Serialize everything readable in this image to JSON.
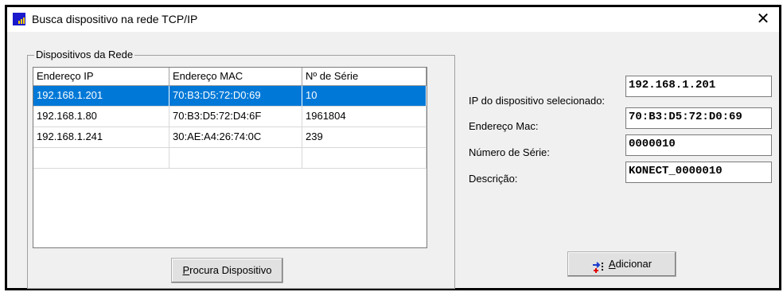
{
  "window": {
    "title": "Busca dispositivo na rede TCP/IP",
    "close_glyph": "✕"
  },
  "group": {
    "label": "Dispositivos da Rede"
  },
  "table": {
    "headers": [
      "Endereço IP",
      "Endereço MAC",
      "Nº de Série"
    ],
    "rows": [
      [
        "192.168.1.201",
        "70:B3:D5:72:D0:69",
        "10"
      ],
      [
        "192.168.1.80",
        "70:B3:D5:72:D4:6F",
        "1961804"
      ],
      [
        "192.168.1.241",
        "30:AE:A4:26:74:0C",
        "239"
      ],
      [
        "",
        "",
        ""
      ]
    ],
    "selected_row": 0
  },
  "buttons": {
    "search_mnemonic": "P",
    "search_rest": "rocura Dispositivo",
    "add_mnemonic": "A",
    "add_rest": "dicionar"
  },
  "fields": {
    "ip": {
      "label": "IP do dispositivo selecionado:",
      "value": "192.168.1.201"
    },
    "mac": {
      "label": "Endereço Mac:",
      "value": "70:B3:D5:72:D0:69"
    },
    "serial": {
      "label": "Número de Série:",
      "value": "0000010"
    },
    "desc": {
      "label": "Descrição:",
      "value": "KONECT_0000010"
    }
  },
  "colors": {
    "selection": "#0078d7",
    "face": "#f0f0f0"
  }
}
